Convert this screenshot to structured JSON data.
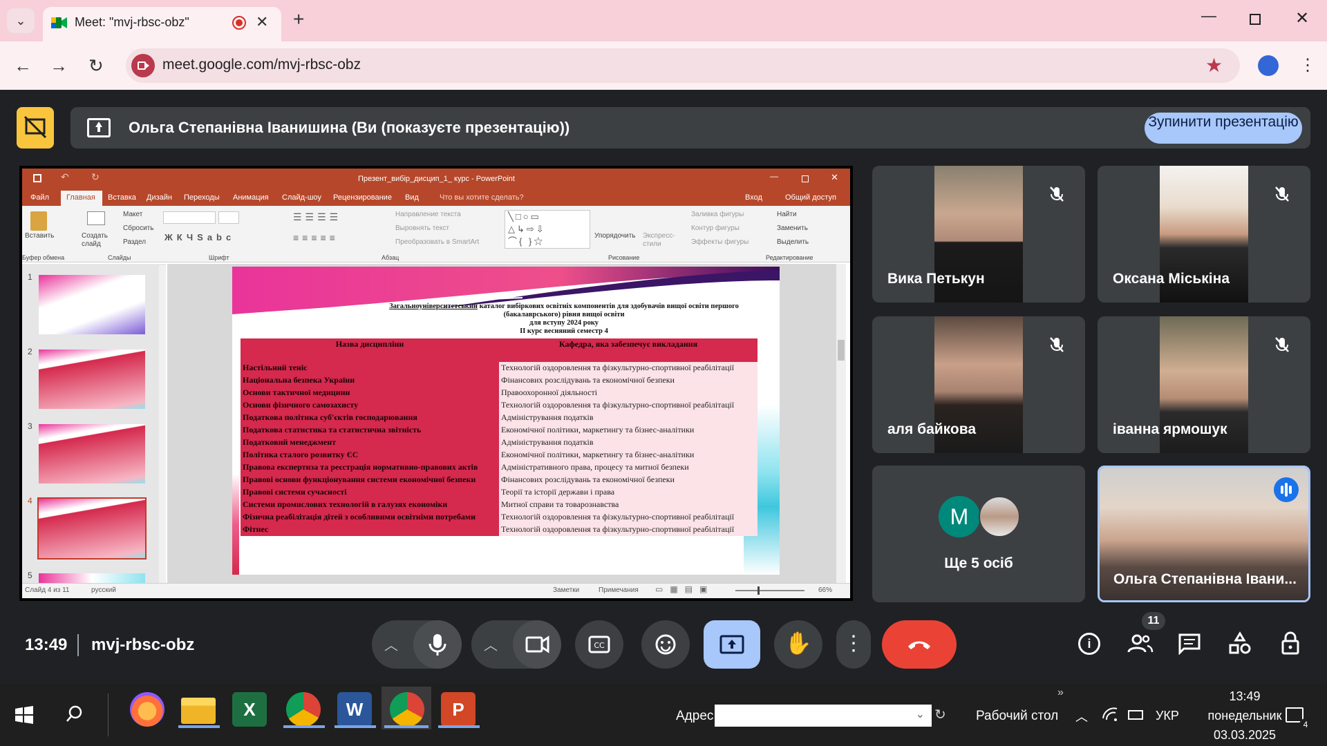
{
  "browser": {
    "tab_title": "Meet: \"mvj-rbsc-obz\"",
    "url": "meet.google.com/mvj-rbsc-obz"
  },
  "banner": {
    "presenter_text": "Ольга Степанівна Іванишина (Ви (показуєте презентацію))",
    "stop_button": "Зупинити презентацію"
  },
  "ppt": {
    "title": "Презент_вибір_дисцип_1_ курс - PowerPoint",
    "tabs": [
      "Файл",
      "Главная",
      "Вставка",
      "Дизайн",
      "Переходы",
      "Анимация",
      "Слайд-шоу",
      "Рецензирование",
      "Вид"
    ],
    "tell_me": "Что вы хотите сделать?",
    "signin": "Вход",
    "share": "Общий доступ",
    "ribbon": {
      "paste": "Вставить",
      "clipboard": "Буфер обмена",
      "new_slide": "Создать слайд",
      "layout": "Макет",
      "reset": "Сбросить",
      "section": "Раздел",
      "slides_group": "Слайды",
      "font_group": "Шрифт",
      "paragraph_group": "Абзац",
      "text_direction": "Направление текста",
      "align_text": "Выровнять текст",
      "smartart": "Преобразовать в SmartArt",
      "arrange": "Упорядочить",
      "quick_styles": "Экспресс-стили",
      "shape_fill": "Заливка фигуры",
      "shape_outline": "Контур фигуры",
      "shape_effects": "Эффекты фигуры",
      "drawing_group": "Рисование",
      "find": "Найти",
      "replace": "Заменить",
      "select": "Выделить",
      "editing_group": "Редактирование"
    },
    "thumbs": [
      "1",
      "2",
      "3",
      "4",
      "5"
    ],
    "status_slide": "Слайд 4 из 11",
    "status_lang": "русский",
    "notes": "Заметки",
    "comments": "Примечания",
    "zoom": "66%"
  },
  "slide": {
    "heading_bold": "Загальноуніверситетський",
    "heading_rest": " каталог вибіркових освітніх компонентів для здобувачів вищої освіти першого",
    "heading_line2": "(бакалаврського) рівня вищої освіти",
    "heading_line3": "для вступу 2024 року",
    "heading_line4": "ІІ курс весняний семестр 4",
    "col1": "Назва дисципліни",
    "col2": "Кафедра, яка забезпечує викладання",
    "rows": [
      [
        "Настільний теніс",
        "Технологій оздоровлення та фізкультурно-спортивної реабілітації"
      ],
      [
        "Національна безпека України",
        "Фінансових розслідувань та економічної безпеки"
      ],
      [
        "Основи тактичної медицини",
        "Правоохоронної діяльності"
      ],
      [
        "Основи фізичного самозахисту",
        "Технологій оздоровлення та фізкультурно-спортивної реабілітації"
      ],
      [
        "Податкова політика суб'єктів господарювання",
        "Адміністрування податків"
      ],
      [
        "Податкова статистика та статистична звітність",
        "Економічної політики, маркетингу та бізнес-аналітики"
      ],
      [
        "Податковий менеджмент",
        "Адміністрування податків"
      ],
      [
        "Політика сталого розвитку ЄС",
        "Економічної політики, маркетингу та бізнес-аналітики"
      ],
      [
        "Правова експертиза та реєстрація нормативно-правових актів",
        "Адміністративного права, процесу та митної безпеки"
      ],
      [
        "Правові основи функціонування системи економічної безпеки",
        "Фінансових розслідувань та економічної безпеки"
      ],
      [
        "Правові системи сучасності",
        "Теорії та історії держави і права"
      ],
      [
        "Системи промислових технологій в галузях економіки",
        "Митної справи та товарознавства"
      ],
      [
        "Фізична реабілітація дітей з особливими освітніми потребами",
        "Технологій оздоровлення та фізкультурно-спортивної реабілітації"
      ],
      [
        "Фітнес",
        "Технологій оздоровлення та фізкультурно-спортивної реабілітації"
      ]
    ]
  },
  "participants": [
    {
      "name": "Вика Петькун"
    },
    {
      "name": "Оксана Міськіна"
    },
    {
      "name": "аля байкова"
    },
    {
      "name": "іванна ярмошук"
    },
    {
      "name": "Ще 5 осіб",
      "avatar_letter": "M"
    },
    {
      "name": "Ольга Степанівна Івани..."
    }
  ],
  "meeting": {
    "time": "13:49",
    "code": "mvj-rbsc-obz",
    "participant_count": "11"
  },
  "taskbar": {
    "address_label": "Адрес",
    "desktop": "Рабочий стол",
    "lang": "УКР",
    "time": "13:49",
    "day": "понедельник",
    "date": "03.03.2025",
    "notif_count": "4"
  },
  "colors": {
    "accent": "#a8c7fa",
    "hangup": "#ea4335",
    "present_active": "#a8c7fa",
    "ppt_red": "#b7472a"
  }
}
